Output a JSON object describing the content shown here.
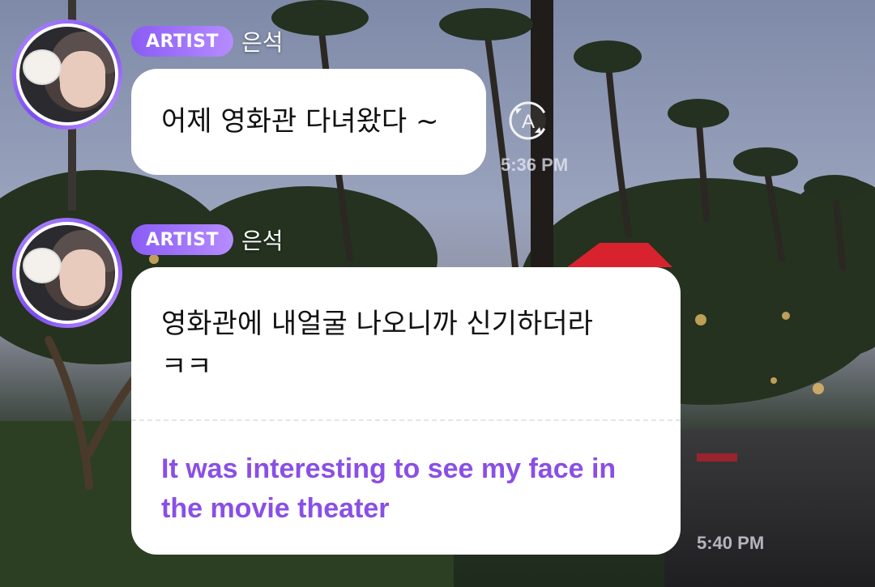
{
  "messages": [
    {
      "badge": "ARTIST",
      "author": "은석",
      "text": "어제 영화관 다녀왔다 ~",
      "time": "5:36 PM"
    },
    {
      "badge": "ARTIST",
      "author": "은석",
      "text_line1": "영화관에 내얼굴 나오니까 신기하더라",
      "text_line2": "ㅋㅋ",
      "translation_line1": "It was interesting to see my face in",
      "translation_line2": "the movie theater",
      "time": "5:40 PM"
    }
  ],
  "icons": {
    "translate": "translate-icon",
    "avatar": "artist-avatar"
  },
  "colors": {
    "badge_start": "#8a5cf6",
    "badge_end": "#b68cff",
    "translation": "#8a4fe6",
    "bubble": "#ffffff"
  }
}
